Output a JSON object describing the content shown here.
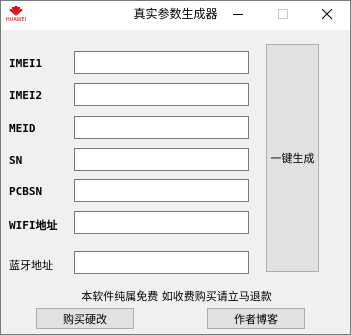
{
  "titlebar": {
    "title": "真实参数生成器",
    "brand": "HUAWEI",
    "brand_color": "#d7000f"
  },
  "fields": [
    {
      "label": "IMEI1",
      "value": ""
    },
    {
      "label": "IMEI2",
      "value": ""
    },
    {
      "label": "MEID",
      "value": ""
    },
    {
      "label": "SN",
      "value": ""
    },
    {
      "label": "PCBSN",
      "value": ""
    },
    {
      "label": "WIFI地址",
      "value": ""
    },
    {
      "label": "蓝牙地址",
      "value": ""
    }
  ],
  "generate_button": "一键生成",
  "notice": "本软件纯属免费 如收费购买请立马退款",
  "buttons": {
    "buy_hardware": "购买硬改",
    "author_blog": "作者博客"
  }
}
